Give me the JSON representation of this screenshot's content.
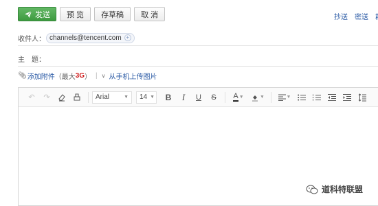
{
  "toolbar": {
    "send_label": "发送",
    "preview_label": "预 览",
    "draft_label": "存草稿",
    "cancel_label": "取 消"
  },
  "right_links": {
    "cc": "抄送",
    "bcc": "密送",
    "group": "群"
  },
  "recipient": {
    "label": "收件人：",
    "email": "channels@tencent.com"
  },
  "subject": {
    "label": "主　题：",
    "value": ""
  },
  "attachment": {
    "add_label": "添加附件",
    "limit_open": "（最大",
    "limit_value": "3G",
    "limit_close": "）",
    "separator": "|",
    "phone_upload": "从手机上传图片"
  },
  "editor": {
    "font_family": "Arial",
    "font_size": "14",
    "bold": "B",
    "italic": "I",
    "underline": "U",
    "strike": "S",
    "font_color": "A"
  },
  "watermark": {
    "text": "道科特联盟"
  },
  "colors": {
    "primary": "#4aa84c",
    "link": "#2a5aa5",
    "limit": "#d02020"
  }
}
